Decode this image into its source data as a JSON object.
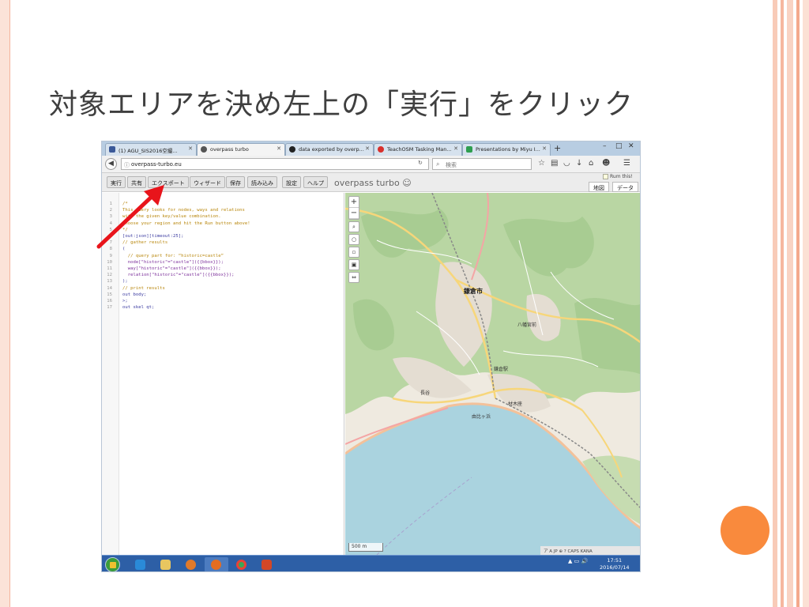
{
  "slide": {
    "title": "対象エリアを決め左上の「実行」をクリック",
    "accent_color": "#f98a3d"
  },
  "browser": {
    "tabs": [
      {
        "label": "(1) AGU_SIS2016空撮...",
        "icon": "facebook-icon",
        "color": "#3b5998",
        "active": false
      },
      {
        "label": "overpass turbo",
        "icon": "overpass-icon",
        "color": "#555555",
        "active": true
      },
      {
        "label": "data exported by overp...",
        "icon": "github-icon",
        "color": "#222222",
        "active": false
      },
      {
        "label": "TeachOSM Tasking Man...",
        "icon": "teachosm-icon",
        "color": "#d9302c",
        "active": false
      },
      {
        "label": "Presentations by Miyu I...",
        "icon": "slides-icon",
        "color": "#2e9e4f",
        "active": false
      }
    ],
    "new_tab": "+",
    "window_controls": [
      "–",
      "□",
      "✕"
    ],
    "url": "overpass-turbo.eu",
    "search_placeholder": "検索"
  },
  "toolbar": {
    "buttons": [
      "実行",
      "共有",
      "エクスポート",
      "ウィザード",
      "保存",
      "読み込み",
      "設定",
      "ヘルプ"
    ],
    "app_title": "overpass turbo",
    "run_check_label": "Rum this!",
    "map_tab": "地図",
    "data_tab": "データ"
  },
  "editor": {
    "lines": [
      {
        "n": "1",
        "text": "/*",
        "cls": "c-comment"
      },
      {
        "n": "2",
        "text": "This query looks for nodes, ways and relations",
        "cls": "c-comment"
      },
      {
        "n": "3",
        "text": "with the given key/value combination.",
        "cls": "c-comment"
      },
      {
        "n": "4",
        "text": "Choose your region and hit the Run button above!",
        "cls": "c-comment"
      },
      {
        "n": "5",
        "text": "*/",
        "cls": "c-comment"
      },
      {
        "n": "6",
        "text": "[out:json][timeout:25];",
        "cls": "c-norm"
      },
      {
        "n": "7",
        "text": "// gather results",
        "cls": "c-comment"
      },
      {
        "n": "8",
        "text": "(",
        "cls": "c-norm"
      },
      {
        "n": "9",
        "text": "  // query part for: “historic=castle”",
        "cls": "c-comment"
      },
      {
        "n": "10",
        "text": "  node[\"historic\"=\"castle\"]({{bbox}});",
        "cls": "c-ell"
      },
      {
        "n": "11",
        "text": "  way[\"historic\"=\"castle\"]({{bbox}});",
        "cls": "c-ell"
      },
      {
        "n": "12",
        "text": "  relation[\"historic\"=\"castle\"]({{bbox}});",
        "cls": "c-ell"
      },
      {
        "n": "13",
        "text": ");",
        "cls": "c-norm"
      },
      {
        "n": "14",
        "text": "// print results",
        "cls": "c-comment"
      },
      {
        "n": "15",
        "text": "out body;",
        "cls": "c-norm"
      },
      {
        "n": "16",
        "text": ">;",
        "cls": "c-norm"
      },
      {
        "n": "17",
        "text": "out skel qt;",
        "cls": "c-norm"
      }
    ]
  },
  "map": {
    "labels": {
      "city": "鎌倉市",
      "label_1": "鎌倉駅",
      "label_2": "長谷",
      "label_3": "材木座",
      "label_4": "八幡宮前",
      "label_5": "由比ヶ浜"
    },
    "scale": "500 m",
    "zoom_in": "+",
    "zoom_out": "−",
    "corner_text": "ア  A  JP  ⊕  ?  CAPS  KANA"
  },
  "taskbar": {
    "time": "17:51",
    "date": "2016/07/14"
  }
}
